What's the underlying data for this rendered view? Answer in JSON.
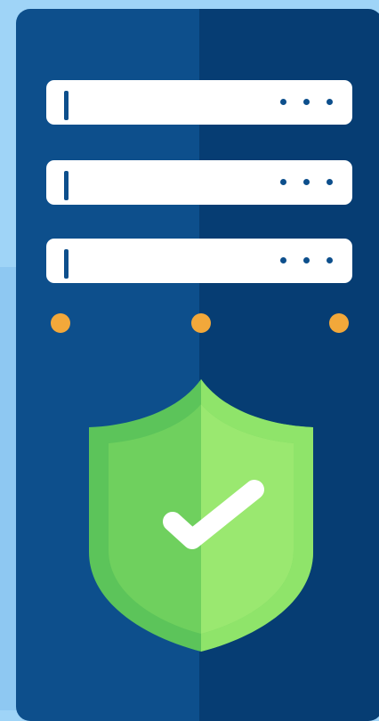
{
  "colors": {
    "background": "#9fd4f7",
    "tower_left": "#0d4f8c",
    "tower_right": "#063d73",
    "drive": "#ffffff",
    "led": "#f2a83a",
    "shield_dark": "#5cc45a",
    "shield_light": "#8fe46a",
    "checkmark": "#ffffff"
  },
  "icons": {
    "tower": "server-icon",
    "shield": "shield-check-icon"
  },
  "drives": [
    {
      "name": "drive-1"
    },
    {
      "name": "drive-2"
    },
    {
      "name": "drive-3"
    }
  ],
  "leds": [
    {
      "name": "led-left"
    },
    {
      "name": "led-center"
    },
    {
      "name": "led-right"
    }
  ]
}
